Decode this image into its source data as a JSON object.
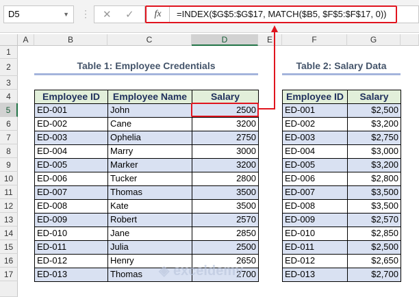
{
  "name_box": "D5",
  "formula_bar": {
    "cancel_icon": "✕",
    "enter_icon": "✓",
    "fx_label": "fx",
    "formula": "=INDEX($G$5:$G$17, MATCH($B5, $F$5:$F$17, 0))"
  },
  "columns": [
    "A",
    "B",
    "C",
    "D",
    "E",
    "F",
    "G"
  ],
  "rows": [
    "1",
    "2",
    "3",
    "4",
    "5",
    "6",
    "7",
    "8",
    "9",
    "10",
    "11",
    "12",
    "13",
    "14",
    "15",
    "16",
    "17"
  ],
  "selected_cell": "D5",
  "colors": {
    "accent_red": "#e0141e",
    "header_fill": "#e2efda",
    "band_fill": "#d9e1f2",
    "excel_green": "#217346"
  },
  "table1": {
    "title": "Table 1: Employee Credentials",
    "headers": [
      "Employee ID",
      "Employee Name",
      "Salary"
    ],
    "rows": [
      [
        "ED-001",
        "John",
        "2500"
      ],
      [
        "ED-002",
        "Cane",
        "3200"
      ],
      [
        "ED-003",
        "Ophelia",
        "2750"
      ],
      [
        "ED-004",
        "Marry",
        "3000"
      ],
      [
        "ED-005",
        "Marker",
        "3200"
      ],
      [
        "ED-006",
        "Tucker",
        "2800"
      ],
      [
        "ED-007",
        "Thomas",
        "3500"
      ],
      [
        "ED-008",
        "Kate",
        "3500"
      ],
      [
        "ED-009",
        "Robert",
        "2570"
      ],
      [
        "ED-010",
        "Jane",
        "2850"
      ],
      [
        "ED-011",
        "Julia",
        "2500"
      ],
      [
        "ED-012",
        "Henry",
        "2650"
      ],
      [
        "ED-013",
        "Thomas",
        "2700"
      ]
    ]
  },
  "table2": {
    "title": "Table 2: Salary Data",
    "headers": [
      "Employee ID",
      "Salary"
    ],
    "rows": [
      [
        "ED-001",
        "$2,500"
      ],
      [
        "ED-002",
        "$3,200"
      ],
      [
        "ED-003",
        "$2,750"
      ],
      [
        "ED-004",
        "$3,000"
      ],
      [
        "ED-005",
        "$3,200"
      ],
      [
        "ED-006",
        "$2,800"
      ],
      [
        "ED-007",
        "$3,500"
      ],
      [
        "ED-008",
        "$3,500"
      ],
      [
        "ED-009",
        "$2,570"
      ],
      [
        "ED-010",
        "$2,850"
      ],
      [
        "ED-011",
        "$2,500"
      ],
      [
        "ED-012",
        "$2,650"
      ],
      [
        "ED-013",
        "$2,700"
      ]
    ]
  },
  "watermark": "exceldemy"
}
